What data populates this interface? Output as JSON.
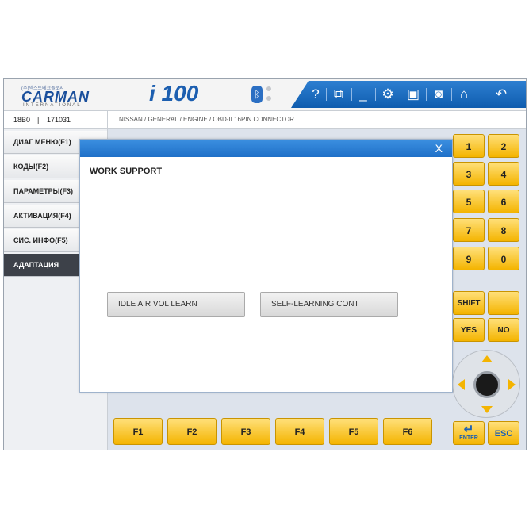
{
  "header": {
    "logo_tiny": "(주)넥스트테크놀로지",
    "logo_brand": "CARMAN",
    "logo_sub": "INTERNATIONAL",
    "model": "i 100",
    "bluetooth_glyph": "ᛒ",
    "toolbar": {
      "help": "?",
      "window": "⧉",
      "minimize": "_",
      "settings": "⚙",
      "save": "▣",
      "camera": "◙",
      "home": "⌂",
      "back": "↶"
    },
    "toolbar_color": "#1f6fc6"
  },
  "info_bar": {
    "ecu_code": "18B0",
    "separator": "|",
    "ecu_number": "171031",
    "vehicle_path": "NISSAN / GENERAL / ENGINE / OBD-II 16PIN CONNECTOR"
  },
  "sidebar": {
    "items": [
      {
        "label": "ДИАГ МЕНЮ(F1)"
      },
      {
        "label": "КОДЫ(F2)"
      },
      {
        "label": "ПАРАМЕТРЫ(F3)"
      },
      {
        "label": "АКТИВАЦИЯ(F4)"
      },
      {
        "label": "СИС. ИНФО(F5)"
      },
      {
        "label": "АДАПТАЦИЯ"
      }
    ],
    "active_index": 5
  },
  "keypad": {
    "numbers": [
      "1",
      "2",
      "3",
      "4",
      "5",
      "6",
      "7",
      "8",
      "9",
      "0"
    ],
    "shift": "SHIFT",
    "yes": "YES",
    "no": "NO",
    "enter_glyph": "↵",
    "enter": "ENTER",
    "esc": "ESC"
  },
  "function_keys": [
    "F1",
    "F2",
    "F3",
    "F4",
    "F5",
    "F6"
  ],
  "modal": {
    "close": "X",
    "title": "WORK SUPPORT",
    "buttons": [
      "IDLE AIR VOL LEARN",
      "SELF-LEARNING CONT"
    ]
  }
}
